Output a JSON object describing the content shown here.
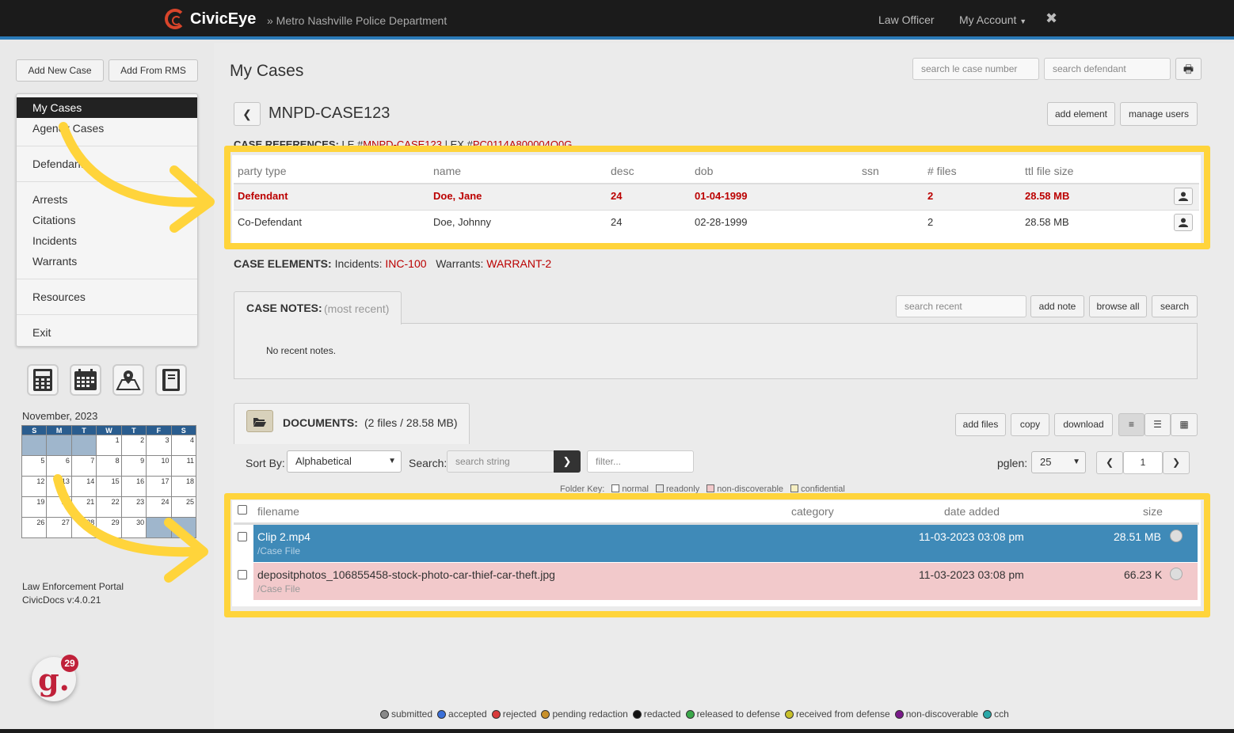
{
  "header": {
    "brand": "CivicEye",
    "org": "» Metro Nashville Police Department",
    "nav": [
      "Law Officer",
      "My Account"
    ]
  },
  "sidebar": {
    "add_case": "Add New Case",
    "add_rms": "Add From RMS",
    "menu": [
      "My Cases",
      "Agency Cases",
      "Defendants",
      "Arrests",
      "Citations",
      "Incidents",
      "Warrants",
      "Resources",
      "Exit"
    ],
    "calendar": {
      "title": "November, 2023",
      "days": [
        "S",
        "M",
        "T",
        "W",
        "T",
        "F",
        "S"
      ],
      "weeks": [
        [
          "",
          "",
          "",
          "1",
          "2",
          "3",
          "4"
        ],
        [
          "5",
          "6",
          "7",
          "8",
          "9",
          "10",
          "11"
        ],
        [
          "12",
          "13",
          "14",
          "15",
          "16",
          "17",
          "18"
        ],
        [
          "19",
          "20",
          "21",
          "22",
          "23",
          "24",
          "25"
        ],
        [
          "26",
          "27",
          "28",
          "29",
          "30",
          "",
          ""
        ]
      ]
    },
    "footer_line1": "Law Enforcement Portal",
    "footer_line2": "CivicDocs v:4.0.21",
    "badge_count": "29"
  },
  "main": {
    "title": "My Cases",
    "search_case_placeholder": "search le case number",
    "search_defendant_placeholder": "search defendant",
    "case_id": "MNPD-CASE123",
    "add_element": "add element",
    "manage_users": "manage users",
    "refs_label": "CASE REFERENCES:",
    "refs_le": "LE #",
    "refs_le_val": "MNPD-CASE123",
    "refs_ex": "| EX #",
    "refs_ex_val": "PC0114A800004O0G",
    "parties": {
      "headers": [
        "party type",
        "name",
        "desc",
        "dob",
        "ssn",
        "# files",
        "ttl file size"
      ],
      "rows": [
        [
          "Defendant",
          "Doe, Jane",
          "24",
          "01-04-1999",
          "",
          "2",
          "28.58 MB"
        ],
        [
          "Co-Defendant",
          "Doe, Johnny",
          "24",
          "02-28-1999",
          "",
          "2",
          "28.58 MB"
        ]
      ]
    },
    "elements_label": "CASE ELEMENTS:",
    "incidents_label": "Incidents:",
    "incidents_val": "INC-100",
    "warrants_label": "Warrants:",
    "warrants_val": "WARRANT-2",
    "notes_label": "CASE NOTES:",
    "notes_sub": "(most recent)",
    "notes_search_placeholder": "search recent",
    "add_note": "add note",
    "browse_all": "browse all",
    "search": "search",
    "no_notes": "No recent notes.",
    "docs_label": "DOCUMENTS:",
    "docs_sub": "(2 files / 28.58 MB)",
    "add_files": "add files",
    "copy": "copy",
    "download": "download",
    "sort_by": "Sort By:",
    "sort_value": "Alphabetical",
    "search_label": "Search:",
    "search_string_placeholder": "search string",
    "filter_placeholder": "filter...",
    "pglen_label": "pglen:",
    "pglen_value": "25",
    "page_value": "1",
    "folder_key": "Folder Key:",
    "folder_key_items": [
      "normal",
      "readonly",
      "non-discoverable",
      "confidential"
    ],
    "files": {
      "headers": [
        "filename",
        "category",
        "date added",
        "size"
      ],
      "rows": [
        {
          "name": "Clip 2.mp4",
          "path": "/Case File",
          "date": "11-03-2023 03:08 pm",
          "size": "28.51 MB"
        },
        {
          "name": "depositphotos_106855458-stock-photo-car-thief-car-theft.jpg",
          "path": "/Case File",
          "date": "11-03-2023 03:08 pm",
          "size": "66.23 K"
        }
      ]
    },
    "legend": [
      {
        "label": "submitted",
        "color": "#888888"
      },
      {
        "label": "accepted",
        "color": "#3a6fd8"
      },
      {
        "label": "rejected",
        "color": "#d83a3a"
      },
      {
        "label": "pending redaction",
        "color": "#c8902a"
      },
      {
        "label": "redacted",
        "color": "#111111"
      },
      {
        "label": "released to defense",
        "color": "#3aa84a"
      },
      {
        "label": "received from defense",
        "color": "#c8c02a"
      },
      {
        "label": "non-discoverable",
        "color": "#7a1a8a"
      },
      {
        "label": "cch",
        "color": "#2aa8a8"
      }
    ],
    "colors": {
      "accent": "#2a7ab8",
      "highlight": "#ffd43b",
      "selected_row": "#3f8ab8",
      "flagged_row": "#f2c9cb",
      "defendant_text": "#b00000"
    }
  }
}
